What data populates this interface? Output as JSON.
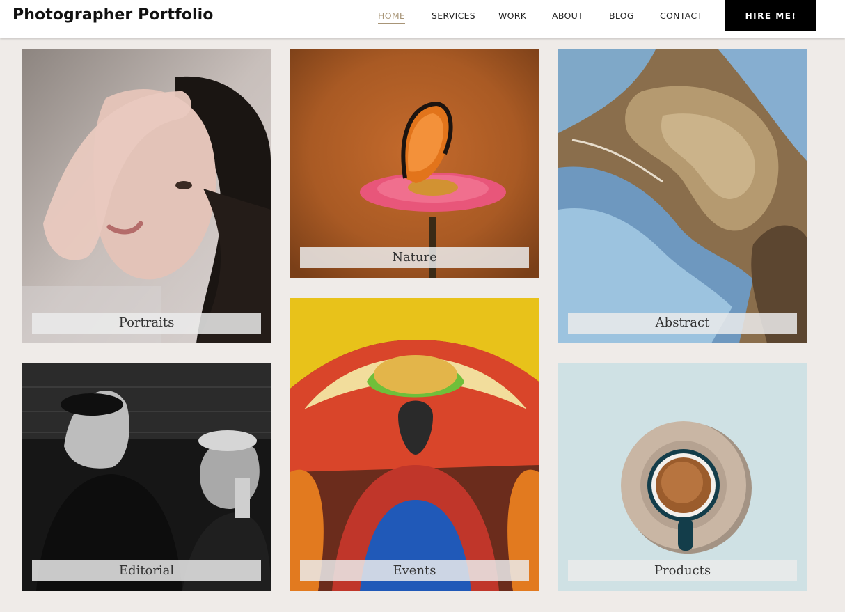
{
  "header": {
    "site_title": "Photographer Portfolio",
    "nav": [
      "HOME",
      "SERVICES",
      "WORK",
      "ABOUT",
      "BLOG",
      "CONTACT"
    ],
    "active": "HOME",
    "cta_label": "HIRE ME!"
  },
  "gallery": {
    "tiles": [
      {
        "caption": "Portraits",
        "image": "portrait-photo"
      },
      {
        "caption": "Nature",
        "image": "butterfly-photo"
      },
      {
        "caption": "Abstract",
        "image": "wood-texture-photo"
      },
      {
        "caption": "Editorial",
        "image": "editorial-photo"
      },
      {
        "caption": "Events",
        "image": "festival-photo"
      },
      {
        "caption": "Products",
        "image": "coffee-cup-photo"
      }
    ]
  },
  "colors": {
    "background": "#efebe8",
    "header_bg": "#ffffff",
    "active_nav": "#a89577",
    "cta_bg": "#000000"
  }
}
